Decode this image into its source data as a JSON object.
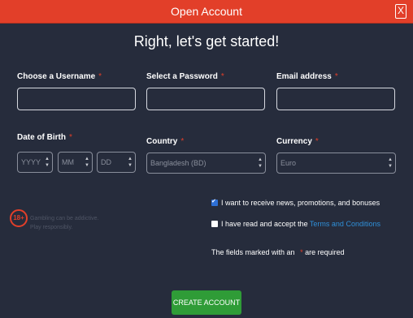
{
  "window": {
    "title": "Open Account",
    "close_label": "X"
  },
  "heading": "Right, let's get started!",
  "required_marker": "*",
  "fields": {
    "username": {
      "label": "Choose a Username"
    },
    "password": {
      "label": "Select a Password"
    },
    "email": {
      "label": "Email address"
    },
    "dob": {
      "label": "Date of Birth",
      "year": "YYYY",
      "month": "MM",
      "day": "DD"
    },
    "country": {
      "label": "Country",
      "value": "Bangladesh (BD)"
    },
    "currency": {
      "label": "Currency",
      "value": "Euro"
    }
  },
  "gambling": {
    "badge": "18+",
    "line1": "Gambling can be addictive.",
    "line2": "Play responsibly."
  },
  "options": {
    "news": {
      "label": "I want to receive news, promotions, and bonuses",
      "checked": true
    },
    "terms": {
      "prefix": "I have read and accept the",
      "link": "Terms and Conditions",
      "checked": false
    }
  },
  "note": {
    "prefix": "The fields marked with an",
    "suffix": "are required"
  },
  "submit_label": "CREATE ACCOUNT",
  "colors": {
    "accent": "#e23f29",
    "background": "#262c3c",
    "submit": "#2f9c37",
    "link": "#2f8fd8"
  }
}
